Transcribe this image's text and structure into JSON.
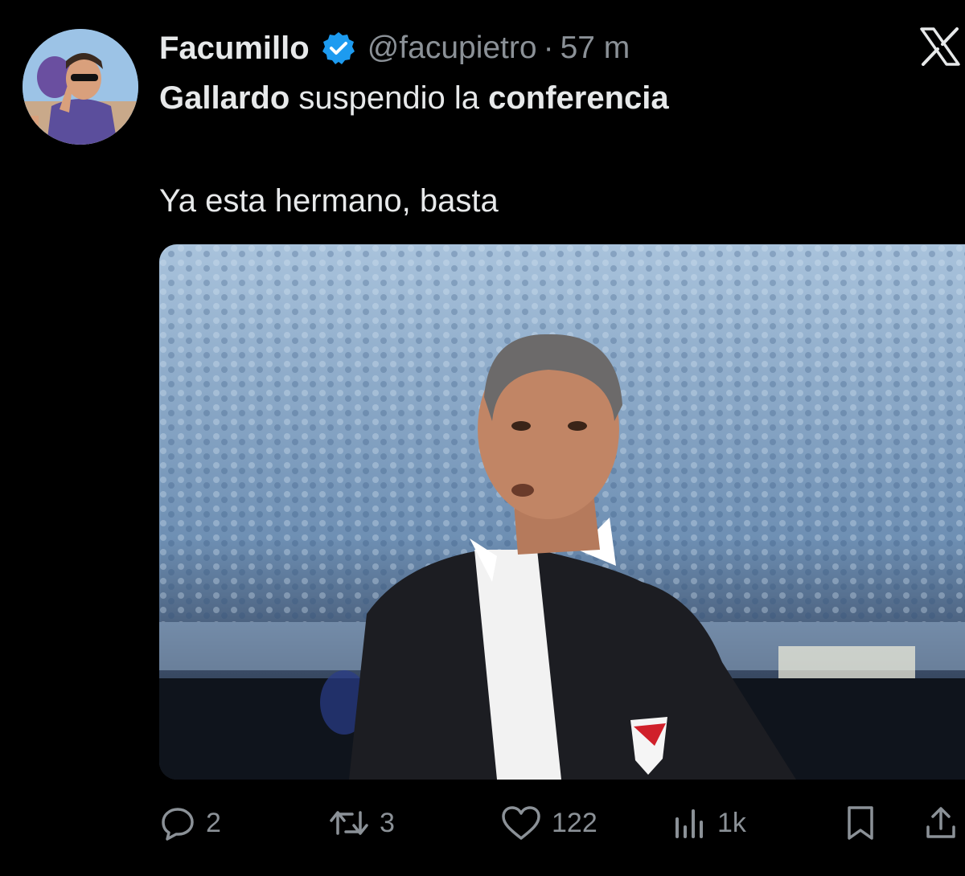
{
  "tweet": {
    "author": {
      "display_name": "Facumillo",
      "handle": "@facupietro",
      "verified": true
    },
    "separator": "·",
    "time": "57 m",
    "text": {
      "line1": [
        {
          "text": "Gallardo",
          "bold": true
        },
        {
          "text": " suspendio la ",
          "bold": false
        },
        {
          "text": "conferencia",
          "bold": true
        }
      ],
      "line2": "Ya esta hermano, basta"
    },
    "media": {
      "type": "photo",
      "description_icon": "photo-image"
    }
  },
  "actions": {
    "reply_count": "2",
    "repost_count": "3",
    "like_count": "122",
    "views_count": "1k"
  },
  "icons": {
    "app_logo": "x-logo-icon",
    "verified": "verified-badge-icon",
    "reply": "reply-icon",
    "repost": "repost-icon",
    "like": "heart-icon",
    "views": "views-chart-icon",
    "bookmark": "bookmark-icon",
    "share": "share-icon"
  },
  "colors": {
    "background": "#000000",
    "text_primary": "#e7e9ea",
    "text_secondary": "#8b9197",
    "verified_blue": "#1d9bf0"
  }
}
